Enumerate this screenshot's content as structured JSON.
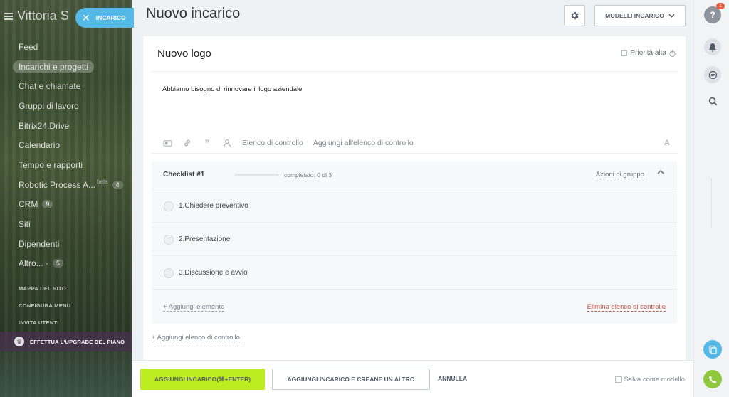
{
  "sidebar": {
    "title": "Vittoria S",
    "items": [
      {
        "label": "Feed"
      },
      {
        "label": "Incarichi e progetti",
        "active": true
      },
      {
        "label": "Chat e chiamate"
      },
      {
        "label": "Gruppi di lavoro"
      },
      {
        "label": "Bitrix24.Drive"
      },
      {
        "label": "Calendario"
      },
      {
        "label": "Tempo e rapporti"
      },
      {
        "label": "Robotic Process A...",
        "beta": "beta",
        "count": "4"
      },
      {
        "label": "CRM",
        "count": "9"
      },
      {
        "label": "Siti"
      },
      {
        "label": "Dipendenti"
      },
      {
        "label": "Altro... ·",
        "count": "5"
      }
    ],
    "sitemap": "MAPPA DEL SITO",
    "configure": "CONFIGURA MENU",
    "invite": "INVITA UTENTI",
    "upgrade": "EFFETTUA L'UPGRADE DEL PIANO"
  },
  "tab": {
    "label": "INCARICO"
  },
  "header": {
    "title": "Nuovo incarico",
    "models_label": "MODELLI INCARICO"
  },
  "task": {
    "title": "Nuovo logo",
    "priority_label": "Priorità alta",
    "description": "Abbiamo bisogno di rinnovare il logo aziendale",
    "toolbar": {
      "checklist_label": "Elenco di controllo",
      "add_checklist_label": "Aggiungi all'elenco di controllo",
      "font_label": "A"
    }
  },
  "checklist": {
    "title": "Checklist #1",
    "progress_fraction": 0,
    "progress_text": "completato: 0 di 3",
    "actions_label": "Azioni di gruppo",
    "items": [
      {
        "label": "1.Chiedere preventivo"
      },
      {
        "label": "2.Presentazione"
      },
      {
        "label": "3.Discussione e avvio"
      }
    ],
    "add_item_label": "+ Aggiungi elemento",
    "delete_label": "Elimina elenco di controllo"
  },
  "add_checklist_link": "+ Aggiungi elenco di controllo",
  "footer": {
    "primary_label": "AGGIUNGI INCARICO(⌘+ENTER)",
    "secondary_label": "AGGIUNGI INCARICO E CREANE UN ALTRO",
    "cancel_label": "ANNULLA",
    "save_template_label": "Salva come modello"
  },
  "right_panel": {
    "help_badge": "1"
  },
  "colors": {
    "primary_button": "#bbed21",
    "tab_pill": "#55b9e8",
    "delete_link": "#c1554b",
    "call_button": "#8fc73e",
    "docs_button": "#55b9e8"
  }
}
